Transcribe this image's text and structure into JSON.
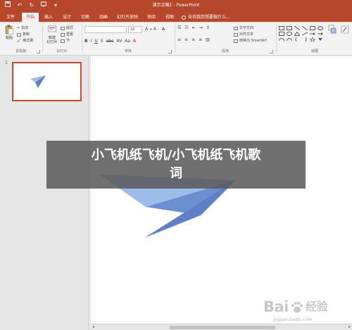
{
  "window": {
    "title": "演示文稿1 - PowerPoint"
  },
  "quick_access": {
    "save_icon": "save-icon",
    "undo_icon": "undo-icon",
    "redo_icon": "redo-icon",
    "present_icon": "present-icon",
    "customize_icon": "customize-icon"
  },
  "tabs": [
    {
      "label": "文件",
      "active": false
    },
    {
      "label": "开始",
      "active": true
    },
    {
      "label": "插入",
      "active": false
    },
    {
      "label": "设计",
      "active": false
    },
    {
      "label": "切换",
      "active": false
    },
    {
      "label": "动画",
      "active": false
    },
    {
      "label": "幻灯片放映",
      "active": false
    },
    {
      "label": "审阅",
      "active": false
    },
    {
      "label": "视图",
      "active": false
    }
  ],
  "tell_me": {
    "placeholder": "告诉我您想要做什么..."
  },
  "ribbon": {
    "clipboard": {
      "paste": "粘贴",
      "cut": "剪切",
      "copy": "复制",
      "format_painter": "格式刷",
      "label": "剪贴板"
    },
    "slides": {
      "new_slide": "新建",
      "new_slide_2": "幻灯片",
      "layout": "版式",
      "reset": "重置",
      "section": "节",
      "label": "幻灯片"
    },
    "font": {
      "size": "18",
      "label": "字体"
    },
    "paragraph": {
      "text_direction": "文字方向",
      "align_text": "对齐文本",
      "smartart": "转换为 SmartArt",
      "label": "段落"
    },
    "drawing": {
      "label": "绘图"
    }
  },
  "slides_panel": {
    "slide_number": "1"
  },
  "overlay": {
    "line1": "小飞机纸飞机/小飞机纸飞机歌",
    "line2": "词"
  },
  "watermark": {
    "brand_left": "Bai",
    "brand_right": "经验",
    "url": "jingyan.baidu.com"
  },
  "colors": {
    "accent": "#b7472a",
    "plane_light": "#9bbde8",
    "plane_dark": "#4b6fb8"
  }
}
